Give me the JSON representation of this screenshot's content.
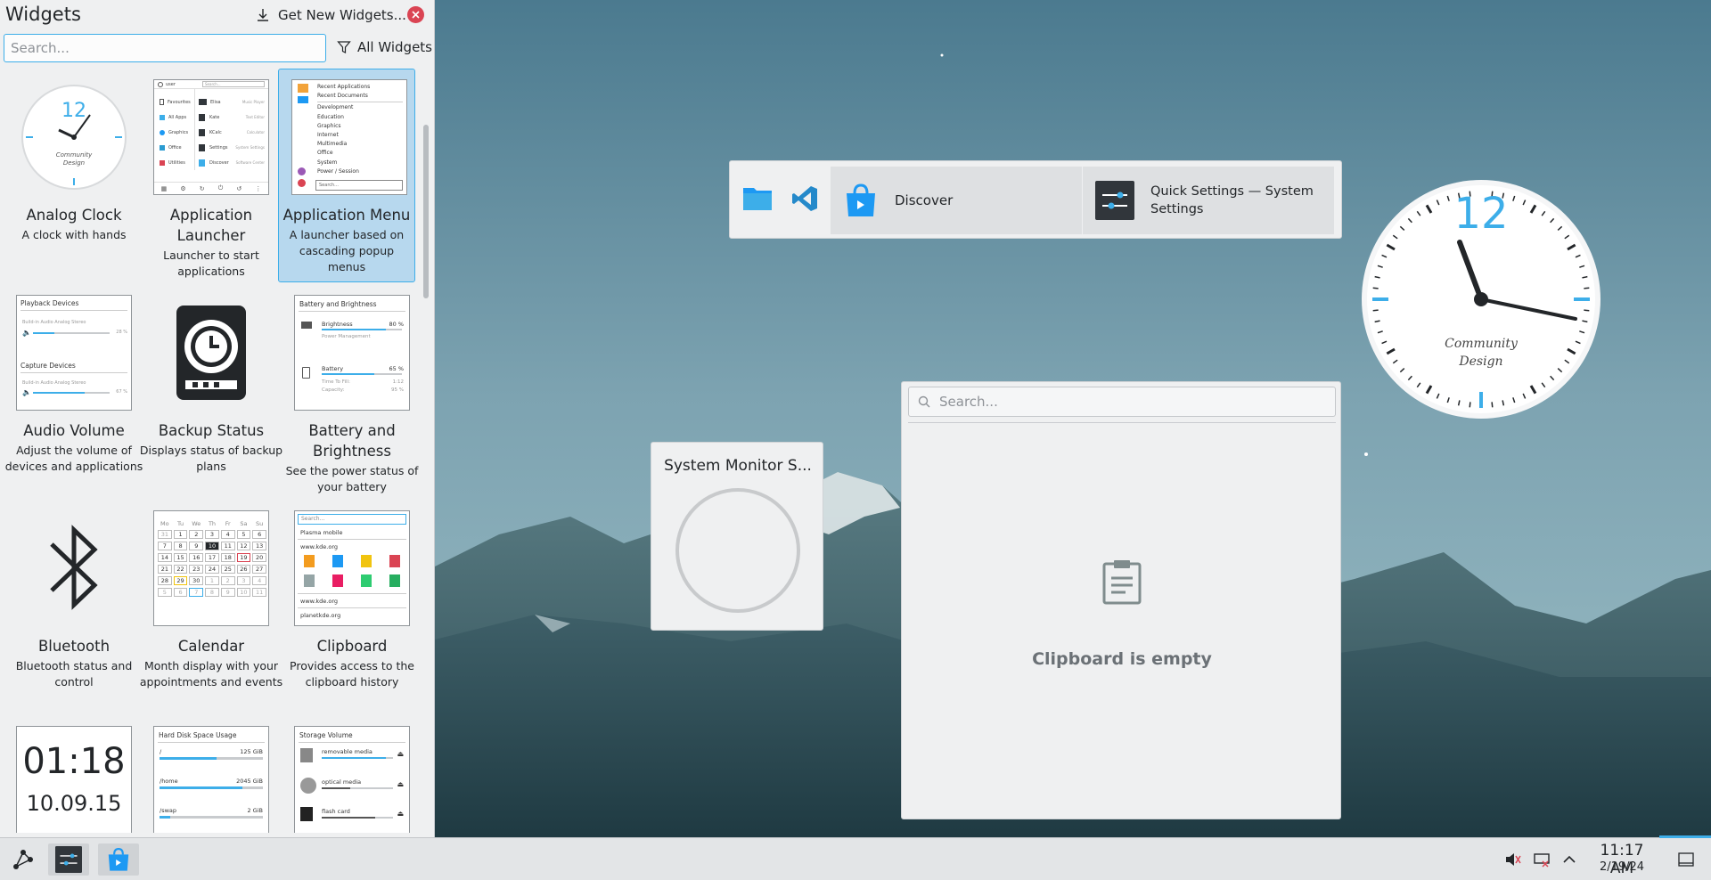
{
  "panel": {
    "title": "Widgets",
    "get_new_label": "Get New Widgets...",
    "search_placeholder": "Search...",
    "filter_label": "All Widgets"
  },
  "widgets": [
    {
      "name": "Analog Clock",
      "desc": "A clock with hands"
    },
    {
      "name": "Application Launcher",
      "desc": "Launcher to start applications"
    },
    {
      "name": "Application Menu",
      "desc": "A launcher based on cascading popup menus",
      "selected": true
    },
    {
      "name": "Audio Volume",
      "desc": "Adjust the volume of devices and applications"
    },
    {
      "name": "Backup Status",
      "desc": "Displays status of backup plans"
    },
    {
      "name": "Battery and Brightness",
      "desc": "See the power status of your battery"
    },
    {
      "name": "Bluetooth",
      "desc": "Bluetooth status and control"
    },
    {
      "name": "Calendar",
      "desc": "Month display with your appointments and events"
    },
    {
      "name": "Clipboard",
      "desc": "Provides access to the clipboard history"
    }
  ],
  "thumbs": {
    "launcher": {
      "user": "user",
      "search": "Search...",
      "items": [
        "Favourites",
        "All Apps",
        "Graphics",
        "Office",
        "Utilities"
      ],
      "apps": [
        "Elisa",
        "Kate",
        "KCalc",
        "Settings",
        "Discover"
      ],
      "app_descs": [
        "Music Player",
        "Text Editor",
        "Calculator",
        "System Settings",
        "Software Center"
      ]
    },
    "appmenu": {
      "items": [
        "Recent Applications",
        "Recent Documents",
        "Development",
        "Education",
        "Graphics",
        "Internet",
        "Multimedia",
        "Office",
        "System",
        "Power / Session"
      ],
      "search": "Search..."
    },
    "audio": {
      "playback": "Playback Devices",
      "capture": "Capture Devices",
      "dev1": "Build-in Audio Analog Stereo",
      "pct1": "28 %",
      "dev2": "Build-in Audio Analog Stereo",
      "pct2": "67 %",
      "level1": 0.28,
      "level2": 0.67
    },
    "battery": {
      "title": "Battery and Brightness",
      "brightness": "Brightness",
      "bright_pct": "80 %",
      "power_mgmt": "Power Management",
      "battery": "Battery",
      "bat_pct": "65 %",
      "time_label": "Time To Fill:",
      "time_val": "1:12",
      "cap_label": "Capacity:",
      "cap_val": "95 %",
      "bright_level": 0.8,
      "bat_level": 0.65
    },
    "calendar": {
      "days": [
        "Mo",
        "Tu",
        "We",
        "Th",
        "Fr",
        "Sa",
        "Su"
      ],
      "cells": [
        "31",
        "1",
        "2",
        "3",
        "4",
        "5",
        "6",
        "7",
        "8",
        "9",
        "10",
        "11",
        "12",
        "13",
        "14",
        "15",
        "16",
        "17",
        "18",
        "19",
        "20",
        "21",
        "22",
        "23",
        "24",
        "25",
        "26",
        "27",
        "28",
        "29",
        "30",
        "1",
        "2",
        "3",
        "4",
        "5",
        "6",
        "7",
        "8",
        "9",
        "10",
        "11"
      ]
    },
    "clipboard": {
      "search": "Search...",
      "l1": "Plasma mobile",
      "l2": "www.kde.org",
      "l3": "www.kde.org",
      "l4": "planetkde.org"
    },
    "digital": {
      "time": "01:18",
      "date": "10.09.15"
    },
    "disk": {
      "title": "Hard Disk Space Usage",
      "rows": [
        {
          "m": "/",
          "v": "125 GiB",
          "level": 0.55
        },
        {
          "m": "/home",
          "v": "2045 GiB",
          "level": 0.8
        },
        {
          "m": "/swap",
          "v": "2 GiB",
          "level": 0.1
        }
      ]
    },
    "storage": {
      "title": "Storage Volume",
      "rows": [
        {
          "m": "removable media",
          "level": 0.9
        },
        {
          "m": "optical media",
          "level": 0.4
        },
        {
          "m": "flash card",
          "level": 0.75
        }
      ]
    }
  },
  "desktop": {
    "launcher_items": [
      {
        "label": "Discover"
      },
      {
        "label": "Quick Settings  — System Settings"
      }
    ],
    "sysmon_title": "System Monitor S...",
    "clipboard": {
      "search_placeholder": "Search...",
      "empty_text": "Clipboard is empty"
    },
    "clock": {
      "twelve": "12",
      "brand_line1": "Community",
      "brand_line2": "Design"
    }
  },
  "taskbar": {
    "time": "11:17 AM",
    "date": "2/19/24"
  },
  "colors": {
    "accent": "#3daee9",
    "close": "#da4453",
    "panel_bg": "#eff0f1"
  }
}
